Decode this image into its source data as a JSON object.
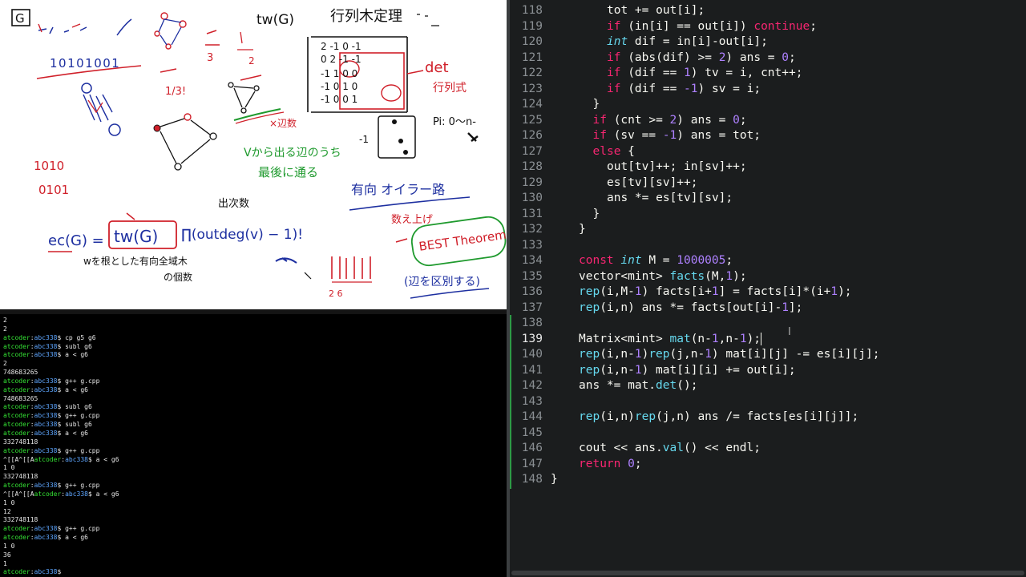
{
  "whiteboard": {
    "label_G": "G",
    "tw_label": "tw(G)",
    "matrix_title": "行列木定理",
    "det_label": "det",
    "det_sub": "行列式",
    "binary_top": "10101001",
    "binary_left_1": "1010",
    "binary_left_2": "0101",
    "frac_a": "1/3!",
    "edges_note": "×辺数",
    "p_note": "Pi: 0〜n-",
    "green_note_1": "Vから出る辺のうち",
    "green_note_2": "最後に通る",
    "euler_title": "有向 オイラー路",
    "out_count": "出次数",
    "formula_left": "ec(G) =",
    "formula_tw": "tw(G)",
    "formula_right": "∏(outdeg(v) − 1)!",
    "count_up": "数え上げ",
    "best": "BEST Theorem",
    "root_note_1": "wを根とした有向全域木",
    "root_note_2": "の個数",
    "distinguish": "(辺を区別する)",
    "matrix_rows": [
      [
        "2",
        "-1",
        "0",
        "-1"
      ],
      [
        "0",
        "2",
        "-1",
        "-1"
      ],
      [
        "-1",
        "1",
        "0",
        "0"
      ],
      [
        "-1",
        "0",
        "1",
        "0"
      ],
      [
        "-1",
        "0",
        "0",
        "1"
      ]
    ]
  },
  "terminal": {
    "lines": [
      {
        "t": "out",
        "text": "2"
      },
      {
        "t": "out",
        "text": "2"
      },
      {
        "t": "cmd",
        "user": "atcoder",
        "host": "abc338",
        "cmd": "cp g5 g6"
      },
      {
        "t": "cmd",
        "user": "atcoder",
        "host": "abc338",
        "cmd": "subl g6"
      },
      {
        "t": "cmd",
        "user": "atcoder",
        "host": "abc338",
        "cmd": "a < g6"
      },
      {
        "t": "out",
        "text": "2"
      },
      {
        "t": "out",
        "text": "748683265"
      },
      {
        "t": "cmd",
        "user": "atcoder",
        "host": "abc338",
        "cmd": "g++ g.cpp"
      },
      {
        "t": "cmd",
        "user": "atcoder",
        "host": "abc338",
        "cmd": "a < g6"
      },
      {
        "t": "out",
        "text": "748683265"
      },
      {
        "t": "cmd",
        "user": "atcoder",
        "host": "abc338",
        "cmd": "subl g6"
      },
      {
        "t": "cmd",
        "user": "atcoder",
        "host": "abc338",
        "cmd": "g++ g.cpp"
      },
      {
        "t": "cmd",
        "user": "atcoder",
        "host": "abc338",
        "cmd": "subl g6"
      },
      {
        "t": "cmd",
        "user": "atcoder",
        "host": "abc338",
        "cmd": "a < g6"
      },
      {
        "t": "out",
        "text": "332748118"
      },
      {
        "t": "cmd",
        "user": "atcoder",
        "host": "abc338",
        "cmd": "g++ g.cpp"
      },
      {
        "t": "cmdp",
        "prefix": "^[[A^[[A",
        "user": "atcoder",
        "host": "abc338",
        "cmd": "a < g6"
      },
      {
        "t": "out",
        "text": "1 0"
      },
      {
        "t": "out",
        "text": "332748118"
      },
      {
        "t": "cmd",
        "user": "atcoder",
        "host": "abc338",
        "cmd": "g++ g.cpp"
      },
      {
        "t": "cmdp",
        "prefix": "^[[A^[[A",
        "user": "atcoder",
        "host": "abc338",
        "cmd": "a < g6"
      },
      {
        "t": "out",
        "text": "1 0"
      },
      {
        "t": "out",
        "text": "12"
      },
      {
        "t": "out",
        "text": "332748118"
      },
      {
        "t": "cmd",
        "user": "atcoder",
        "host": "abc338",
        "cmd": "g++ g.cpp"
      },
      {
        "t": "cmd",
        "user": "atcoder",
        "host": "abc338",
        "cmd": "a < g6"
      },
      {
        "t": "out",
        "text": "1 0"
      },
      {
        "t": "out",
        "text": "36"
      },
      {
        "t": "out",
        "text": "1"
      },
      {
        "t": "cmd",
        "user": "atcoder",
        "host": "abc338",
        "cmd": ""
      }
    ]
  },
  "editor": {
    "current_line": 139,
    "lines": [
      {
        "n": 118,
        "i": 4,
        "tok": [
          [
            "",
            "tot += out[i];"
          ]
        ]
      },
      {
        "n": 119,
        "i": 4,
        "tok": [
          [
            "kw",
            "if"
          ],
          [
            "",
            " (in[i] == out[i]) "
          ],
          [
            "kw",
            "continue"
          ],
          [
            "",
            ";"
          ]
        ]
      },
      {
        "n": 120,
        "i": 4,
        "tok": [
          [
            "ty",
            "int"
          ],
          [
            "",
            " dif = in[i]-out[i];"
          ]
        ]
      },
      {
        "n": 121,
        "i": 4,
        "tok": [
          [
            "kw",
            "if"
          ],
          [
            "",
            " (abs(dif) >= "
          ],
          [
            "nm",
            "2"
          ],
          [
            "",
            ") ans = "
          ],
          [
            "nm",
            "0"
          ],
          [
            "",
            ";"
          ]
        ]
      },
      {
        "n": 122,
        "i": 4,
        "tok": [
          [
            "kw",
            "if"
          ],
          [
            "",
            " (dif == "
          ],
          [
            "nm",
            "1"
          ],
          [
            "",
            ") tv = i, cnt++;"
          ]
        ]
      },
      {
        "n": 123,
        "i": 4,
        "tok": [
          [
            "kw",
            "if"
          ],
          [
            "",
            " (dif == "
          ],
          [
            "nm",
            "-1"
          ],
          [
            "",
            ") sv = i;"
          ]
        ]
      },
      {
        "n": 124,
        "i": 3,
        "tok": [
          [
            "",
            "}"
          ]
        ]
      },
      {
        "n": 125,
        "i": 3,
        "tok": [
          [
            "kw",
            "if"
          ],
          [
            "",
            " (cnt >= "
          ],
          [
            "nm",
            "2"
          ],
          [
            "",
            ") ans = "
          ],
          [
            "nm",
            "0"
          ],
          [
            "",
            ";"
          ]
        ]
      },
      {
        "n": 126,
        "i": 3,
        "tok": [
          [
            "kw",
            "if"
          ],
          [
            "",
            " (sv == "
          ],
          [
            "nm",
            "-1"
          ],
          [
            "",
            ") ans = tot;"
          ]
        ]
      },
      {
        "n": 127,
        "i": 3,
        "tok": [
          [
            "kw",
            "else"
          ],
          [
            "",
            " {"
          ]
        ]
      },
      {
        "n": 128,
        "i": 4,
        "tok": [
          [
            "",
            "out[tv]++; in[sv]++;"
          ]
        ]
      },
      {
        "n": 129,
        "i": 4,
        "tok": [
          [
            "",
            "es[tv][sv]++;"
          ]
        ]
      },
      {
        "n": 130,
        "i": 4,
        "tok": [
          [
            "",
            "ans *= es[tv][sv];"
          ]
        ]
      },
      {
        "n": 131,
        "i": 3,
        "tok": [
          [
            "",
            "}"
          ]
        ]
      },
      {
        "n": 132,
        "i": 2,
        "tok": [
          [
            "",
            "}"
          ]
        ]
      },
      {
        "n": 133,
        "i": 0,
        "tok": []
      },
      {
        "n": 134,
        "i": 2,
        "tok": [
          [
            "kw",
            "const"
          ],
          [
            "",
            " "
          ],
          [
            "ty",
            "int"
          ],
          [
            "",
            " M = "
          ],
          [
            "nm",
            "1000005"
          ],
          [
            "",
            ";"
          ]
        ]
      },
      {
        "n": 135,
        "i": 2,
        "tok": [
          [
            "",
            "vector<mint> "
          ],
          [
            "fn",
            "facts"
          ],
          [
            "",
            "(M,"
          ],
          [
            "nm",
            "1"
          ],
          [
            "",
            ");"
          ]
        ]
      },
      {
        "n": 136,
        "i": 2,
        "tok": [
          [
            "fn",
            "rep"
          ],
          [
            "",
            "(i,M-"
          ],
          [
            "nm",
            "1"
          ],
          [
            "",
            ") facts[i+"
          ],
          [
            "nm",
            "1"
          ],
          [
            "",
            "] = facts[i]*(i+"
          ],
          [
            "nm",
            "1"
          ],
          [
            "",
            ");"
          ]
        ]
      },
      {
        "n": 137,
        "i": 2,
        "tok": [
          [
            "fn",
            "rep"
          ],
          [
            "",
            "(i,n) ans *= facts[out[i]-"
          ],
          [
            "nm",
            "1"
          ],
          [
            "",
            "];"
          ]
        ]
      },
      {
        "n": 138,
        "i": 0,
        "tok": []
      },
      {
        "n": 139,
        "i": 2,
        "tok": [
          [
            "",
            "Matrix<mint> "
          ],
          [
            "fn",
            "mat"
          ],
          [
            "",
            "(n-"
          ],
          [
            "nm",
            "1"
          ],
          [
            "",
            ",n-"
          ],
          [
            "nm",
            "1"
          ],
          [
            "",
            ");"
          ]
        ],
        "caret": true
      },
      {
        "n": 140,
        "i": 2,
        "tok": [
          [
            "fn",
            "rep"
          ],
          [
            "",
            "(i,n-"
          ],
          [
            "nm",
            "1"
          ],
          [
            "",
            ")"
          ],
          [
            "fn",
            "rep"
          ],
          [
            "",
            "(j,n-"
          ],
          [
            "nm",
            "1"
          ],
          [
            "",
            ") mat[i][j] -= es[i][j];"
          ]
        ]
      },
      {
        "n": 141,
        "i": 2,
        "tok": [
          [
            "fn",
            "rep"
          ],
          [
            "",
            "(i,n-"
          ],
          [
            "nm",
            "1"
          ],
          [
            "",
            ") mat[i][i] += out[i];"
          ]
        ]
      },
      {
        "n": 142,
        "i": 2,
        "tok": [
          [
            "",
            "ans *= mat."
          ],
          [
            "fn",
            "det"
          ],
          [
            "",
            "();"
          ]
        ]
      },
      {
        "n": 143,
        "i": 0,
        "tok": []
      },
      {
        "n": 144,
        "i": 2,
        "tok": [
          [
            "fn",
            "rep"
          ],
          [
            "",
            "(i,n)"
          ],
          [
            "fn",
            "rep"
          ],
          [
            "",
            "(j,n) ans /= facts[es[i][j]];"
          ]
        ]
      },
      {
        "n": 145,
        "i": 0,
        "tok": []
      },
      {
        "n": 146,
        "i": 2,
        "tok": [
          [
            "",
            "cout << ans."
          ],
          [
            "fn",
            "val"
          ],
          [
            "",
            "() << endl;"
          ]
        ]
      },
      {
        "n": 147,
        "i": 2,
        "tok": [
          [
            "kw",
            "return"
          ],
          [
            "",
            " "
          ],
          [
            "nm",
            "0"
          ],
          [
            "",
            ";"
          ]
        ]
      },
      {
        "n": 148,
        "i": 0,
        "tok": [
          [
            "",
            "}"
          ]
        ]
      }
    ]
  },
  "colors": {
    "editor_bg": "#1b1d1e",
    "keyword": "#f92672",
    "type": "#66d9ef",
    "number": "#ae81ff",
    "terminal_user": "#34e234",
    "terminal_host": "#5ea6ff",
    "ink_red": "#d0202a",
    "ink_blue": "#1d2fa0",
    "ink_green": "#1f9a2e"
  }
}
